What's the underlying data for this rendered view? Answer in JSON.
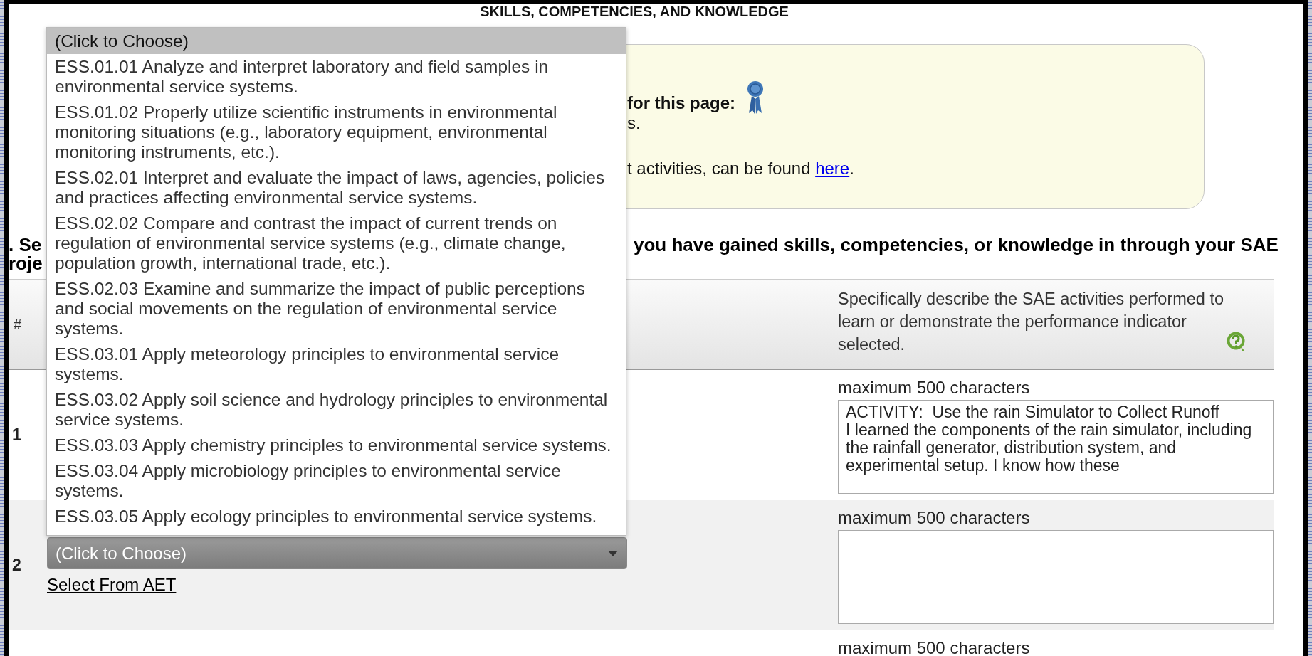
{
  "title": "SKILLS, COMPETENCIES, AND KNOWLEDGE",
  "info_box": {
    "lines": [
      {
        "kind": "heading",
        "text": "for this page:"
      },
      {
        "kind": "text",
        "text": "s."
      },
      {
        "kind": "link_line",
        "text": "t activities, can be found ",
        "link": "here",
        "after": "."
      }
    ]
  },
  "section_heading": {
    "left_fragments": [
      ". Se",
      "roje"
    ],
    "text": "you have gained skills, competencies, or knowledge in through your SAE"
  },
  "table": {
    "columns": {
      "number": "#",
      "description": "Specifically describe the SAE activities performed to learn or demonstrate the performance indicator selected."
    },
    "rows": [
      {
        "number": "1",
        "hint": "maximum 500 characters",
        "value": "ACTIVITY:  Use the rain Simulator to Collect Runoff\nI learned the components of the rain simulator, including the rainfall generator, distribution system, and experimental setup. I know how these"
      },
      {
        "number": "2",
        "hint": "maximum 500 characters",
        "select": {
          "value": "(Click to Choose)",
          "expanded": true,
          "options": [
            {
              "label": "(Click to Choose)",
              "selected": true
            },
            {
              "label": "ESS.01.01 Analyze and interpret laboratory and field samples in environmental service systems.",
              "selected": false
            },
            {
              "label": "ESS.01.02 Properly utilize scientific instruments in environmental monitoring situations (e.g., laboratory equipment, environmental monitoring instruments, etc.).",
              "selected": false
            },
            {
              "label": "ESS.02.01 Interpret and evaluate the impact of laws, agencies, policies and practices affecting environmental service systems.",
              "selected": false
            },
            {
              "label": "ESS.02.02 Compare and contrast the impact of current trends on regulation of environmental service systems (e.g., climate change, population growth, international trade, etc.).",
              "selected": false
            },
            {
              "label": "ESS.02.03 Examine and summarize the impact of public perceptions and social movements on the regulation of environmental service systems.",
              "selected": false
            },
            {
              "label": "ESS.03.01 Apply meteorology principles to environmental service systems.",
              "selected": false
            },
            {
              "label": "ESS.03.02 Apply soil science and hydrology principles to environmental service systems.",
              "selected": false
            },
            {
              "label": "ESS.03.03 Apply chemistry principles to environmental service systems.",
              "selected": false
            },
            {
              "label": "ESS.03.04 Apply microbiology principles to environmental service systems.",
              "selected": false
            },
            {
              "label": "ESS.03.05 Apply ecology principles to environmental service systems.",
              "selected": false
            }
          ]
        },
        "link": "Select From AET"
      },
      {
        "hint": "maximum 500 characters"
      }
    ]
  }
}
